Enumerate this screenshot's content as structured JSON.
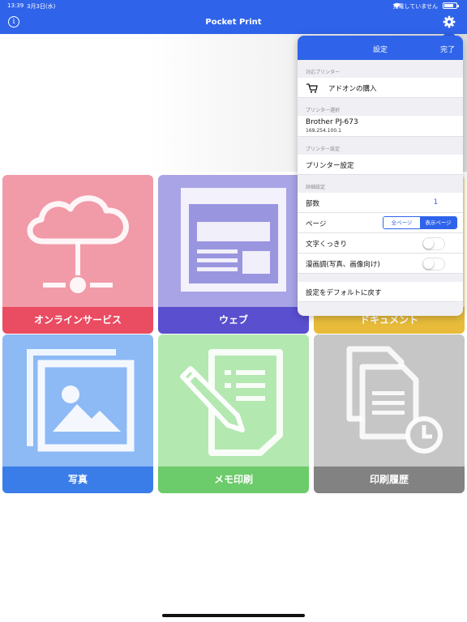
{
  "status": {
    "time": "13:39",
    "date": "3月3日(水)",
    "charging": "充電していません"
  },
  "app": {
    "title": "Pocket Print",
    "info_icon": "info-icon",
    "settings_icon": "gear-icon",
    "accent": "#2f63e9"
  },
  "tiles": [
    {
      "label": "オンラインサービス",
      "icon": "cloud-network-icon"
    },
    {
      "label": "ウェブ",
      "icon": "webpage-icon"
    },
    {
      "label": "ドキュメント",
      "icon": "document-icon"
    },
    {
      "label": "写真",
      "icon": "photo-icon"
    },
    {
      "label": "メモ印刷",
      "icon": "memo-pencil-icon"
    },
    {
      "label": "印刷履歴",
      "icon": "print-history-icon"
    }
  ],
  "settings": {
    "title": "設定",
    "done": "完了",
    "section_supported": "対応プリンター",
    "addon": "アドオンの購入",
    "section_select": "プリンター選択",
    "printer_name": "Brother PJ-673",
    "printer_ip": "169.254.100.1",
    "section_printer_settings": "プリンター設定",
    "printer_settings": "プリンター設定",
    "section_detail": "詳細設定",
    "copies_label": "部数",
    "copies_value": "1",
    "page_label": "ページ",
    "page_options": [
      "全ページ",
      "表示ページ"
    ],
    "page_selected": "表示ページ",
    "sharp_text": "文字くっきり",
    "sharp_text_on": false,
    "manga": "漫画調(写真、画像向け)",
    "manga_on": false,
    "reset_default": "設定をデフォルトに戻す"
  }
}
